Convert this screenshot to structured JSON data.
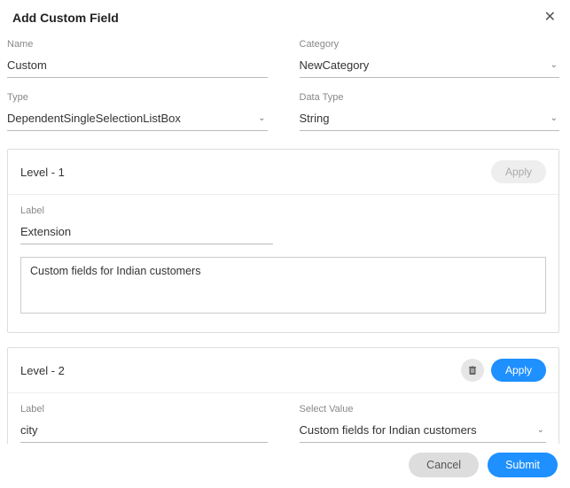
{
  "dialog": {
    "title": "Add Custom Field"
  },
  "fields": {
    "name": {
      "label": "Name",
      "value": "Custom"
    },
    "category": {
      "label": "Category",
      "value": "NewCategory"
    },
    "type": {
      "label": "Type",
      "value": "DependentSingleSelectionListBox"
    },
    "dataType": {
      "label": "Data Type",
      "value": "String"
    }
  },
  "levels": [
    {
      "title": "Level - 1",
      "apply_label": "Apply",
      "apply_enabled": false,
      "label_caption": "Label",
      "label_value": "Extension",
      "description_value": "Custom fields for Indian customers"
    },
    {
      "title": "Level - 2",
      "apply_label": "Apply",
      "apply_enabled": true,
      "has_delete": true,
      "label_caption": "Label",
      "label_value": "city",
      "select_caption": "Select Value",
      "select_value": "Custom fields for Indian customers"
    }
  ],
  "footer": {
    "cancel": "Cancel",
    "submit": "Submit"
  }
}
